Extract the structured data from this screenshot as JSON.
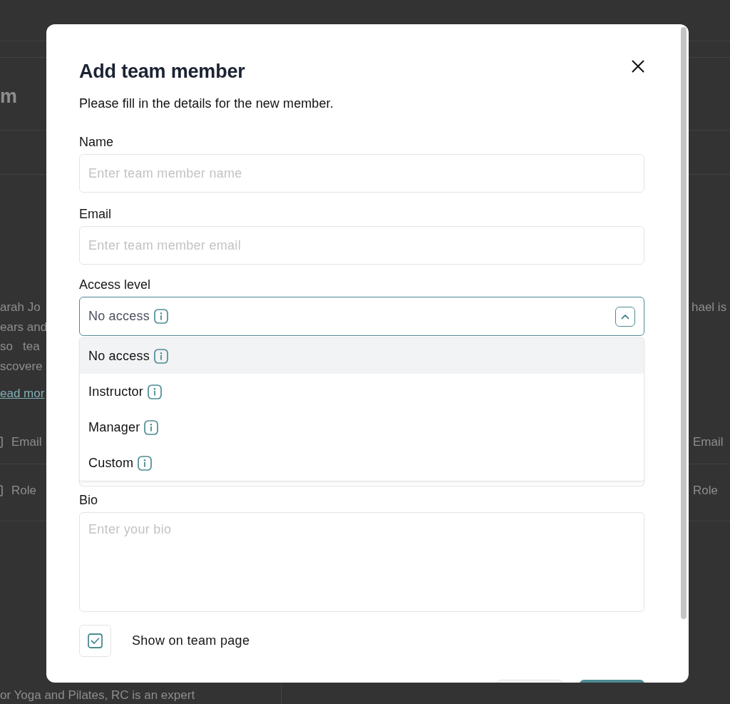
{
  "background_page": {
    "heading": "m",
    "left_column": {
      "bio_lines": [
        "arah Jo",
        "ears and",
        "so   tea",
        "scovere"
      ],
      "link": "ead mor",
      "detail_rows": [
        {
          "label": "Email"
        },
        {
          "label": "Role"
        }
      ],
      "footer_text": "or Yoga and Pilates, RC is an expert"
    },
    "right_column": {
      "bio_lines": [
        "hael is"
      ],
      "detail_rows": [
        {
          "label": "Email"
        },
        {
          "label": "Role"
        }
      ]
    }
  },
  "dialog": {
    "title": "Add team member",
    "subtitle": "Please fill in the details for the new member.",
    "fields": [
      {
        "kind": "text",
        "label": "Name",
        "placeholder": "Enter team member name"
      },
      {
        "kind": "text",
        "label": "Email",
        "placeholder": "Enter team member email"
      },
      {
        "kind": "select",
        "label": "Access level",
        "value": "No access",
        "expanded": true,
        "options": [
          {
            "label": "No access",
            "selected": true
          },
          {
            "label": "Instructor",
            "selected": false
          },
          {
            "label": "Manager",
            "selected": false
          },
          {
            "label": "Custom",
            "selected": false
          }
        ]
      },
      {
        "kind": "covered_input"
      },
      {
        "kind": "textarea",
        "label": "Bio",
        "placeholder": "Enter your bio"
      },
      {
        "kind": "checkbox",
        "label": "Show on team page",
        "checked": true
      }
    ],
    "footer_buttons": [
      {
        "kind": "secondary"
      },
      {
        "kind": "primary"
      }
    ]
  }
}
